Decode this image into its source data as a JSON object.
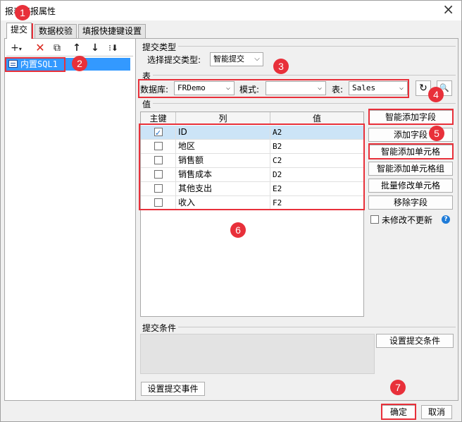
{
  "window": {
    "title": "报表填报属性"
  },
  "tabs": [
    {
      "label": "提交"
    },
    {
      "label": "数据校验"
    },
    {
      "label": "填报快捷键设置"
    }
  ],
  "tree": {
    "item": "内置SQL1"
  },
  "submit_type": {
    "section": "提交类型",
    "label": "选择提交类型:",
    "value": "智能提交"
  },
  "table_section": {
    "section": "表",
    "db_label": "数据库:",
    "db_value": "FRDemo",
    "mode_label": "模式:",
    "mode_value": "",
    "table_label": "表:",
    "table_value": "Sales"
  },
  "values_section": {
    "section": "值",
    "col_key": "主键",
    "col_col": "列",
    "col_val": "值",
    "rows": [
      {
        "key": true,
        "col": "ID",
        "val": "A2"
      },
      {
        "key": false,
        "col": "地区",
        "val": "B2"
      },
      {
        "key": false,
        "col": "销售额",
        "val": "C2"
      },
      {
        "key": false,
        "col": "销售成本",
        "val": "D2"
      },
      {
        "key": false,
        "col": "其他支出",
        "val": "E2"
      },
      {
        "key": false,
        "col": "收入",
        "val": "F2"
      }
    ]
  },
  "side_buttons": {
    "smart_add_field": "智能添加字段",
    "add_field": "添加字段",
    "smart_add_cell": "智能添加单元格",
    "smart_add_cell_group": "智能添加单元格组",
    "batch_modify_cell": "批量修改单元格",
    "remove_field": "移除字段",
    "no_update_unmodified": "未修改不更新"
  },
  "condition": {
    "section": "提交条件",
    "set_button": "设置提交条件",
    "event_button": "设置提交事件"
  },
  "footer": {
    "ok": "确定",
    "cancel": "取消"
  },
  "badges": [
    "1",
    "2",
    "3",
    "4",
    "5",
    "6",
    "7"
  ],
  "colors": {
    "accent_red": "#e8303a",
    "selection_blue": "#3399ff"
  }
}
